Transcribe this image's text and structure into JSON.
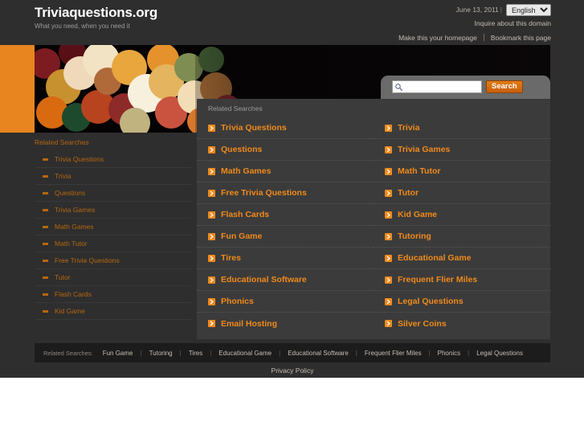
{
  "header": {
    "brand_title": "Triviaquestions.org",
    "tagline": "What you need, when you need it",
    "date": "June 13, 2011",
    "date_separator": "|",
    "language_selected": "English",
    "language_options": [
      "English"
    ],
    "inquire_link": "Inquire about this domain",
    "homepage_link": "Make this your homepage",
    "bookmark_link": "Bookmark this page"
  },
  "search": {
    "placeholder": "",
    "value": "",
    "button_label": "Search",
    "icon": "search-icon"
  },
  "results": {
    "title": "Related Searches",
    "bullet_icon": "arrow-right-icon",
    "column_left": [
      "Trivia Questions",
      "Questions",
      "Math Games",
      "Free Trivia Questions",
      "Flash Cards",
      "Fun Game",
      "Tires",
      "Educational Software",
      "Phonics",
      "Email Hosting"
    ],
    "column_right": [
      "Trivia",
      "Trivia Games",
      "Math Tutor",
      "Tutor",
      "Kid Game",
      "Tutoring",
      "Educational Game",
      "Frequent Flier Miles",
      "Legal Questions",
      "Silver Coins"
    ]
  },
  "sidebar": {
    "title": "Related Searches",
    "bullet_icon": "dash-icon",
    "items": [
      "Trivia Questions",
      "Trivia",
      "Questions",
      "Trivia Games",
      "Math Games",
      "Math Tutor",
      "Free Trivia Questions",
      "Tutor",
      "Flash Cards",
      "Kid Game"
    ]
  },
  "footer": {
    "title": "Related Searches:",
    "links": [
      "Fun Game",
      "Tutoring",
      "Tires",
      "Educational Game",
      "Educational Software",
      "Frequent Flier Miles",
      "Phonics",
      "Legal Questions"
    ],
    "separator": "|",
    "privacy_label": "Privacy Policy"
  },
  "colors": {
    "page_background": "#2e2e2e",
    "panel_background": "#3b3b3b",
    "accent_orange": "#f08a1c",
    "accent_orange_dark": "#b5670f",
    "banner_orange": "#e8851f",
    "search_button": "#c85f0d",
    "footer_bar": "#1c1c1c",
    "muted_text": "#c6bdb1"
  }
}
